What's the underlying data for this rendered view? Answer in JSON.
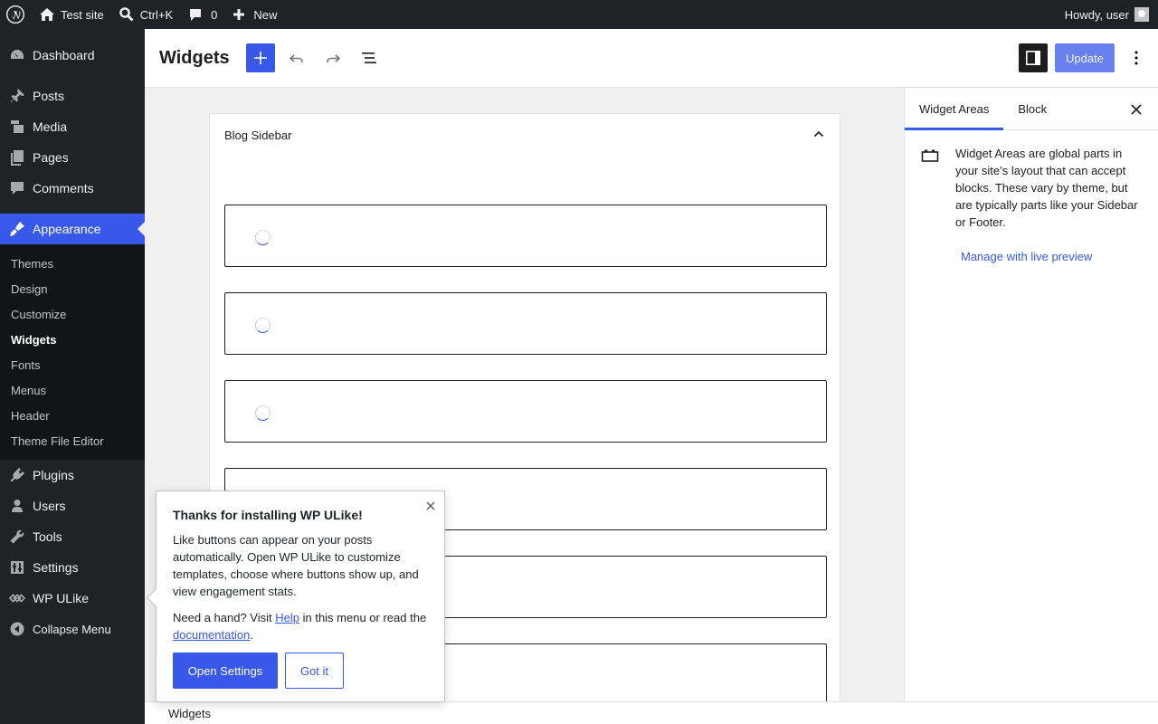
{
  "admin_bar": {
    "site_name": "Test site",
    "search_shortcut": "Ctrl+K",
    "comments_count": "0",
    "new_label": "New",
    "greeting": "Howdy, user"
  },
  "menu": {
    "dashboard": "Dashboard",
    "posts": "Posts",
    "media": "Media",
    "pages": "Pages",
    "comments": "Comments",
    "appearance": "Appearance",
    "submenu": [
      "Themes",
      "Design",
      "Customize",
      "Widgets",
      "Fonts",
      "Menus",
      "Header",
      "Theme File Editor"
    ],
    "plugins": "Plugins",
    "users": "Users",
    "tools": "Tools",
    "settings": "Settings",
    "wp_ulike": "WP ULike",
    "collapse": "Collapse Menu"
  },
  "header": {
    "title": "Widgets",
    "update_label": "Update"
  },
  "widget_area": {
    "title": "Blog Sidebar"
  },
  "inspector": {
    "tab_widget_areas": "Widget Areas",
    "tab_block": "Block",
    "description": "Widget Areas are global parts in your site’s layout that can accept blocks. These vary by theme, but are typically parts like your Sidebar or Footer.",
    "live_preview_link": "Manage with live preview"
  },
  "footer": {
    "breadcrumb": "Widgets"
  },
  "popup": {
    "title": "Thanks for installing WP ULike!",
    "body": "Like buttons can appear on your posts automatically. Open WP ULike to customize templates, choose where buttons show up, and view engagement stats.",
    "help_prefix": "Need a hand? Visit ",
    "help_link": "Help",
    "help_middle": " in this menu or read the ",
    "doc_link": "documentation",
    "help_suffix": ".",
    "open_settings": "Open Settings",
    "got_it": "Got it"
  },
  "colors": {
    "accent": "#3858e9",
    "admin_bg": "#1d2327"
  }
}
